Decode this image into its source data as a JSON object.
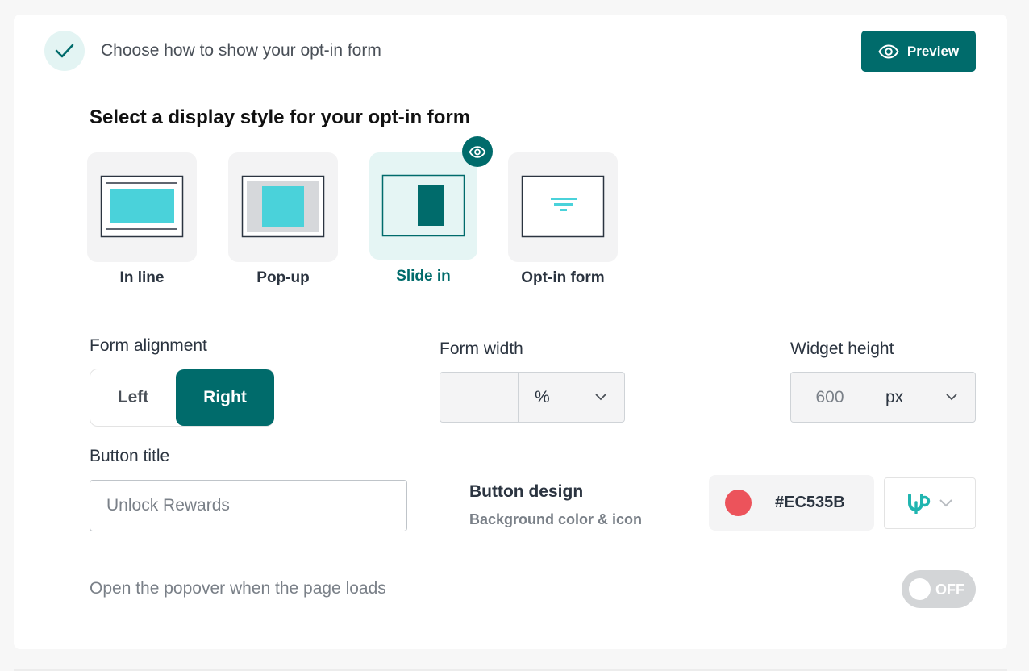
{
  "header": {
    "title": "Choose how to show your opt-in form",
    "preview_label": "Preview"
  },
  "display_style": {
    "title": "Select a display style for your opt-in form",
    "options": [
      {
        "label": "In line",
        "selected": false
      },
      {
        "label": "Pop-up",
        "selected": false
      },
      {
        "label": "Slide in",
        "selected": true
      },
      {
        "label": "Opt-in form",
        "selected": false
      }
    ]
  },
  "form_alignment": {
    "label": "Form alignment",
    "options": [
      "Left",
      "Right"
    ],
    "selected": "Right"
  },
  "form_width": {
    "label": "Form width",
    "value": "",
    "unit": "%"
  },
  "widget_height": {
    "label": "Widget height",
    "value": "600",
    "unit": "px"
  },
  "button_title": {
    "label": "Button title",
    "placeholder": "Unlock Rewards"
  },
  "button_design": {
    "title": "Button design",
    "subtitle": "Background color & icon",
    "color_hex": "#EC535B",
    "icon": "up-logo-icon"
  },
  "popover": {
    "label": "Open the popover when the page loads",
    "toggle_text": "OFF",
    "enabled": false
  },
  "colors": {
    "accent": "#006B6B",
    "tile_fill": "#4AD2DA",
    "swatch": "#EC535B"
  }
}
